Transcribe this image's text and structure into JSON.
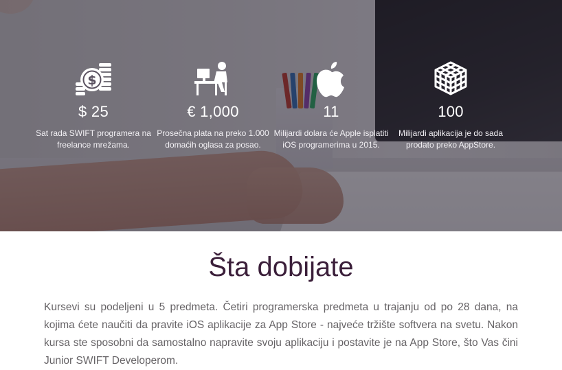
{
  "stats": [
    {
      "icon": "coins-dollar-icon",
      "value": "$ 25",
      "description": "Sat rada SWIFT programera na freelance mrežama."
    },
    {
      "icon": "developer-desk-icon",
      "value": "€ 1,000",
      "description": "Prosečna plata na preko 1.000 domaćih oglasa za posao."
    },
    {
      "icon": "apple-icon",
      "value": "11",
      "description": "Milijardi dolara će Apple isplatiti iOS programerima u 2015."
    },
    {
      "icon": "cube-grid-icon",
      "value": "100",
      "description": "Milijardi aplikacija je do sada prodato preko AppStore."
    }
  ],
  "section": {
    "title": "Šta dobijate",
    "body": "Kursevi su podeljeni u 5 predmeta. Četiri programerska predmeta u trajanju od po 28 dana, na kojima ćete naučiti da pravite iOS aplikacije za App Store - najveće tržište softvera na svetu. Nakon kursa ste sposobni da samostalno napravite svoju aplikaciju i postavite je na App Store, što Vas čini Junior SWIFT Developerom."
  },
  "colors": {
    "title": "#3b1f3a",
    "body_text": "#666366",
    "overlay": "#1e1928",
    "stat_text": "#ffffff"
  }
}
